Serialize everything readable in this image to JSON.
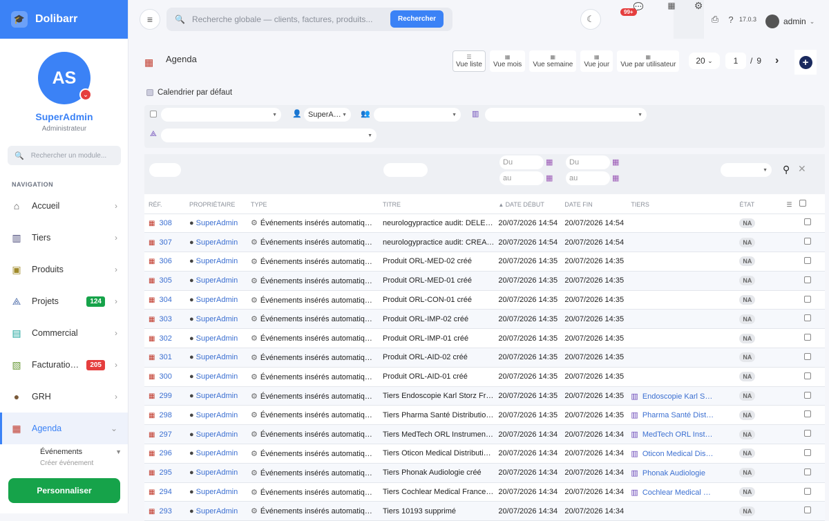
{
  "brand": {
    "name": "Dolibarr",
    "icon": "graduation-cap-icon"
  },
  "profile": {
    "initials": "AS",
    "name": "SuperAdmin",
    "role": "Administrateur"
  },
  "module_search": {
    "placeholder": "Rechercher un module..."
  },
  "nav_header": "NAVIGATION",
  "nav": [
    {
      "label": "Accueil",
      "icon": "home-icon",
      "color": "#555"
    },
    {
      "label": "Tiers",
      "icon": "building-icon",
      "color": "#4a4a7a"
    },
    {
      "label": "Produits",
      "icon": "box-icon",
      "color": "#a08a2a"
    },
    {
      "label": "Projets",
      "icon": "project-icon",
      "color": "#4a6aa8",
      "badge": "124",
      "badge_color": "#16a34a"
    },
    {
      "label": "Commercial",
      "icon": "briefcase-icon",
      "color": "#1aa39a"
    },
    {
      "label": "Facturatio…",
      "icon": "invoice-icon",
      "color": "#6a9a3a",
      "badge": "205",
      "badge_color": "#e53e3e"
    },
    {
      "label": "GRH",
      "icon": "user-icon",
      "color": "#7a5a3a"
    },
    {
      "label": "Agenda",
      "icon": "calendar-icon",
      "color": "#c0392b",
      "active": true
    }
  ],
  "subnav": {
    "events": "Événements",
    "create_event": "Créer événement"
  },
  "personalize": "Personnaliser",
  "topbar": {
    "search_placeholder": "Recherche globale — clients, factures, produits...",
    "search_button": "Rechercher",
    "chat_badge": "99+",
    "version": "17.0.3",
    "user": "admin"
  },
  "page": {
    "title": "Agenda",
    "views": [
      "Vue liste",
      "Vue mois",
      "Vue semaine",
      "Vue jour",
      "Vue par utilisateur"
    ],
    "active_view": "Vue liste",
    "page_size": "20",
    "page_current": "1",
    "page_total": "9",
    "default_calendar": "Calendrier par défaut"
  },
  "filters": {
    "owner": "SuperA…"
  },
  "date_filters": {
    "from": "Du",
    "to": "au"
  },
  "columns": [
    "RÉF.",
    "PROPRIÉTAIRE",
    "TYPE",
    "TITRE",
    "DATE DÉBUT",
    "DATE FIN",
    "TIERS",
    "ÉTAT"
  ],
  "rows": [
    {
      "ref": "308",
      "owner": "SuperAdmin",
      "type": "Événements insérés automatiq…",
      "title": "neurologypractice audit: DELE…",
      "start": "20/07/2026 14:54",
      "end": "20/07/2026 14:54",
      "tiers": "",
      "state": "NA"
    },
    {
      "ref": "307",
      "owner": "SuperAdmin",
      "type": "Événements insérés automatiq…",
      "title": "neurologypractice audit: CREA…",
      "start": "20/07/2026 14:54",
      "end": "20/07/2026 14:54",
      "tiers": "",
      "state": "NA"
    },
    {
      "ref": "306",
      "owner": "SuperAdmin",
      "type": "Événements insérés automatiq…",
      "title": "Produit ORL-MED-02 créé",
      "start": "20/07/2026 14:35",
      "end": "20/07/2026 14:35",
      "tiers": "",
      "state": "NA"
    },
    {
      "ref": "305",
      "owner": "SuperAdmin",
      "type": "Événements insérés automatiq…",
      "title": "Produit ORL-MED-01 créé",
      "start": "20/07/2026 14:35",
      "end": "20/07/2026 14:35",
      "tiers": "",
      "state": "NA"
    },
    {
      "ref": "304",
      "owner": "SuperAdmin",
      "type": "Événements insérés automatiq…",
      "title": "Produit ORL-CON-01 créé",
      "start": "20/07/2026 14:35",
      "end": "20/07/2026 14:35",
      "tiers": "",
      "state": "NA"
    },
    {
      "ref": "303",
      "owner": "SuperAdmin",
      "type": "Événements insérés automatiq…",
      "title": "Produit ORL-IMP-02 créé",
      "start": "20/07/2026 14:35",
      "end": "20/07/2026 14:35",
      "tiers": "",
      "state": "NA"
    },
    {
      "ref": "302",
      "owner": "SuperAdmin",
      "type": "Événements insérés automatiq…",
      "title": "Produit ORL-IMP-01 créé",
      "start": "20/07/2026 14:35",
      "end": "20/07/2026 14:35",
      "tiers": "",
      "state": "NA"
    },
    {
      "ref": "301",
      "owner": "SuperAdmin",
      "type": "Événements insérés automatiq…",
      "title": "Produit ORL-AID-02 créé",
      "start": "20/07/2026 14:35",
      "end": "20/07/2026 14:35",
      "tiers": "",
      "state": "NA"
    },
    {
      "ref": "300",
      "owner": "SuperAdmin",
      "type": "Événements insérés automatiq…",
      "title": "Produit ORL-AID-01 créé",
      "start": "20/07/2026 14:35",
      "end": "20/07/2026 14:35",
      "tiers": "",
      "state": "NA"
    },
    {
      "ref": "299",
      "owner": "SuperAdmin",
      "type": "Événements insérés automatiq…",
      "title": "Tiers Endoscopie Karl Storz Fr…",
      "start": "20/07/2026 14:35",
      "end": "20/07/2026 14:35",
      "tiers": "Endoscopie Karl S…",
      "state": "NA"
    },
    {
      "ref": "298",
      "owner": "SuperAdmin",
      "type": "Événements insérés automatiq…",
      "title": "Tiers Pharma Santé Distributio…",
      "start": "20/07/2026 14:35",
      "end": "20/07/2026 14:35",
      "tiers": "Pharma Santé Dist…",
      "state": "NA"
    },
    {
      "ref": "297",
      "owner": "SuperAdmin",
      "type": "Événements insérés automatiq…",
      "title": "Tiers MedTech ORL Instrumen…",
      "start": "20/07/2026 14:34",
      "end": "20/07/2026 14:34",
      "tiers": "MedTech ORL Inst…",
      "state": "NA"
    },
    {
      "ref": "296",
      "owner": "SuperAdmin",
      "type": "Événements insérés automatiq…",
      "title": "Tiers Oticon Medical Distributi…",
      "start": "20/07/2026 14:34",
      "end": "20/07/2026 14:34",
      "tiers": "Oticon Medical Dis…",
      "state": "NA"
    },
    {
      "ref": "295",
      "owner": "SuperAdmin",
      "type": "Événements insérés automatiq…",
      "title": "Tiers Phonak Audiologie créé",
      "start": "20/07/2026 14:34",
      "end": "20/07/2026 14:34",
      "tiers": "Phonak Audiologie",
      "state": "NA"
    },
    {
      "ref": "294",
      "owner": "SuperAdmin",
      "type": "Événements insérés automatiq…",
      "title": "Tiers Cochlear Medical France…",
      "start": "20/07/2026 14:34",
      "end": "20/07/2026 14:34",
      "tiers": "Cochlear Medical …",
      "state": "NA"
    },
    {
      "ref": "293",
      "owner": "SuperAdmin",
      "type": "Événements insérés automatiq…",
      "title": "Tiers 10193 supprimé",
      "start": "20/07/2026 14:34",
      "end": "20/07/2026 14:34",
      "tiers": "",
      "state": "NA"
    }
  ]
}
